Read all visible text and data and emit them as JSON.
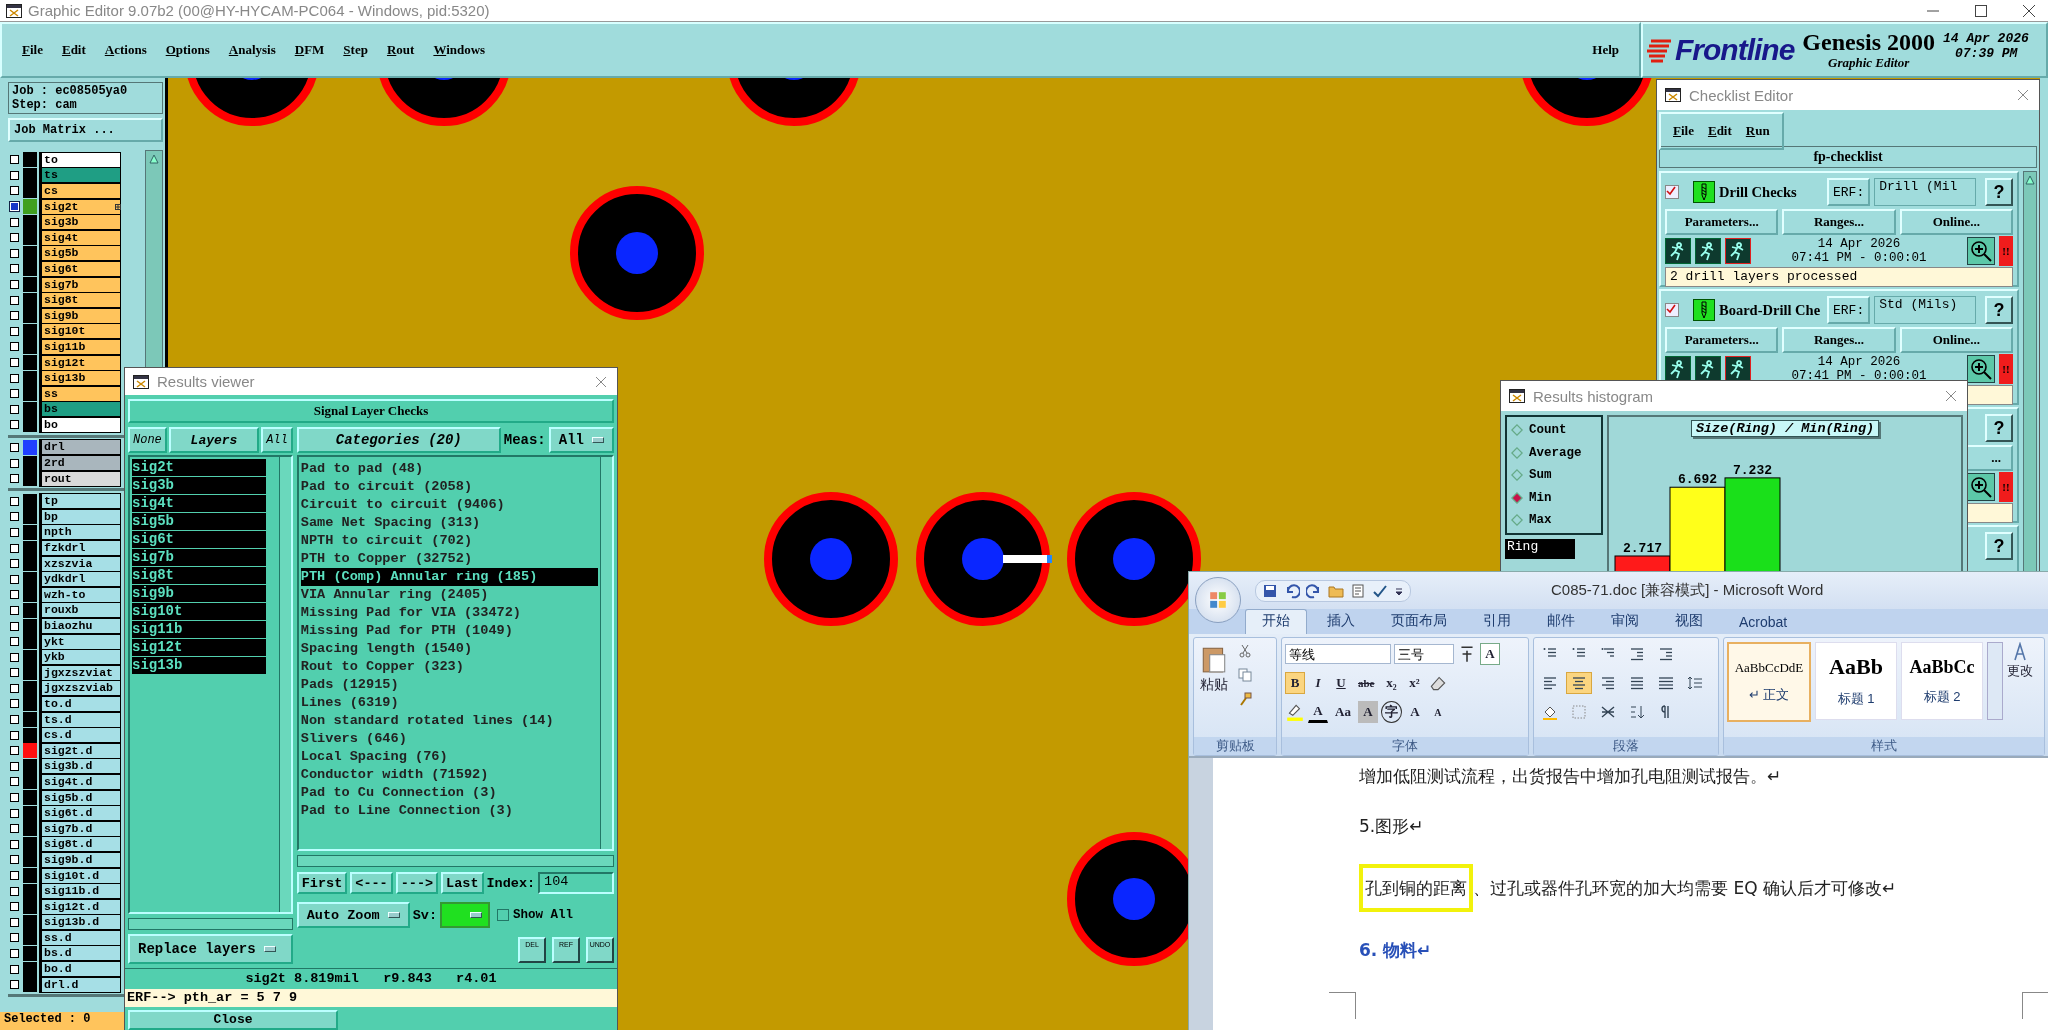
{
  "app": {
    "title": "Graphic Editor 9.07b2 (00@HY-HYCAM-PC064 - Windows, pid:5320)",
    "menu": [
      "File",
      "Edit",
      "Actions",
      "Options",
      "Analysis",
      "DFM",
      "Step",
      "Rout",
      "Windows"
    ],
    "help": "Help",
    "logo": {
      "brand": "Frontline",
      "product": "Genesis 2000",
      "subtitle": "Graphic Editor",
      "date": "14 Apr 2026",
      "time": "07:39 PM"
    }
  },
  "sidebar": {
    "job": "Job : ec08505ya0",
    "step": "Step: cam",
    "matrix_button": "Job Matrix ...",
    "selected_count": "Selected : 0",
    "sections": [
      [
        {
          "name": "to",
          "kind": "silk",
          "selected": false
        },
        {
          "name": "ts",
          "kind": "mask",
          "selected": false
        },
        {
          "name": "cs",
          "kind": "signal",
          "selected": false
        },
        {
          "name": "sig2t",
          "kind": "signal",
          "selected": true,
          "color": "#40a020"
        },
        {
          "name": "sig3b",
          "kind": "signal",
          "selected": false
        },
        {
          "name": "sig4t",
          "kind": "signal",
          "selected": false
        },
        {
          "name": "sig5b",
          "kind": "signal",
          "selected": false
        },
        {
          "name": "sig6t",
          "kind": "signal",
          "selected": false
        },
        {
          "name": "sig7b",
          "kind": "signal",
          "selected": false
        },
        {
          "name": "sig8t",
          "kind": "signal",
          "selected": false
        },
        {
          "name": "sig9b",
          "kind": "signal",
          "selected": false
        },
        {
          "name": "sig10t",
          "kind": "signal",
          "selected": false
        },
        {
          "name": "sig11b",
          "kind": "signal",
          "selected": false
        },
        {
          "name": "sig12t",
          "kind": "signal",
          "selected": false
        },
        {
          "name": "sig13b",
          "kind": "signal",
          "selected": false
        },
        {
          "name": "ss",
          "kind": "signal",
          "selected": false
        },
        {
          "name": "bs",
          "kind": "mask",
          "selected": false
        },
        {
          "name": "bo",
          "kind": "silk",
          "selected": false
        }
      ],
      [
        {
          "name": "drl",
          "kind": "drill",
          "selected": false,
          "color": "#2040ff"
        },
        {
          "name": "2rd",
          "kind": "drill",
          "selected": false
        },
        {
          "name": "rout",
          "kind": "rout",
          "selected": false
        }
      ],
      [
        {
          "name": "tp",
          "kind": "misc",
          "selected": false
        },
        {
          "name": "bp",
          "kind": "misc",
          "selected": false
        },
        {
          "name": "npth",
          "kind": "misc",
          "selected": false
        },
        {
          "name": "fzkdrl",
          "kind": "misc",
          "selected": false
        },
        {
          "name": "xzszvia",
          "kind": "misc",
          "selected": false
        },
        {
          "name": "ydkdrl",
          "kind": "misc",
          "selected": false
        },
        {
          "name": "wzh-to",
          "kind": "misc",
          "selected": false
        },
        {
          "name": "rouxb",
          "kind": "misc",
          "selected": false
        },
        {
          "name": "biaozhu",
          "kind": "misc",
          "selected": false
        },
        {
          "name": "ykt",
          "kind": "misc",
          "selected": false
        },
        {
          "name": "ykb",
          "kind": "misc",
          "selected": false
        },
        {
          "name": "jgxzszviat",
          "kind": "misc",
          "selected": false
        },
        {
          "name": "jgxzszviab",
          "kind": "misc",
          "selected": false
        },
        {
          "name": "to.d",
          "kind": "misc",
          "selected": false
        },
        {
          "name": "ts.d",
          "kind": "misc",
          "selected": false
        },
        {
          "name": "cs.d",
          "kind": "misc",
          "selected": false
        },
        {
          "name": "sig2t.d",
          "kind": "misc",
          "selected": false,
          "color": "#ff1010"
        },
        {
          "name": "sig3b.d",
          "kind": "misc",
          "selected": false
        },
        {
          "name": "sig4t.d",
          "kind": "misc",
          "selected": false
        },
        {
          "name": "sig5b.d",
          "kind": "misc",
          "selected": false
        },
        {
          "name": "sig6t.d",
          "kind": "misc",
          "selected": false
        },
        {
          "name": "sig7b.d",
          "kind": "misc",
          "selected": false
        },
        {
          "name": "sig8t.d",
          "kind": "misc",
          "selected": false
        },
        {
          "name": "sig9b.d",
          "kind": "misc",
          "selected": false
        },
        {
          "name": "sig10t.d",
          "kind": "misc",
          "selected": false
        },
        {
          "name": "sig11b.d",
          "kind": "misc",
          "selected": false
        },
        {
          "name": "sig12t.d",
          "kind": "misc",
          "selected": false
        },
        {
          "name": "sig13b.d",
          "kind": "misc",
          "selected": false
        },
        {
          "name": "ss.d",
          "kind": "misc",
          "selected": false
        },
        {
          "name": "bs.d",
          "kind": "misc",
          "selected": false
        },
        {
          "name": "bo.d",
          "kind": "misc",
          "selected": false
        },
        {
          "name": "drl.d",
          "kind": "misc",
          "selected": false
        }
      ]
    ]
  },
  "results_viewer": {
    "title": "Results viewer",
    "header": "Signal Layer Checks",
    "layer_buttons": [
      "None",
      "Layers",
      "All"
    ],
    "layers": [
      {
        "name": "sig2t",
        "selected": true
      },
      {
        "name": "sig3b",
        "selected": true
      },
      {
        "name": "sig4t",
        "selected": true
      },
      {
        "name": "sig5b",
        "selected": true
      },
      {
        "name": "sig6t",
        "selected": true
      },
      {
        "name": "sig7b",
        "selected": true
      },
      {
        "name": "sig8t",
        "selected": true
      },
      {
        "name": "sig9b",
        "selected": true
      },
      {
        "name": "sig10t",
        "selected": true
      },
      {
        "name": "sig11b",
        "selected": true
      },
      {
        "name": "sig12t",
        "selected": true
      },
      {
        "name": "sig13b",
        "selected": true
      }
    ],
    "layer_action": "Replace layers",
    "categories_button": "Categories (20)",
    "meas_label": "Meas:",
    "meas_value": "All",
    "categories": [
      {
        "label": "Pad to pad (48)",
        "selected": false
      },
      {
        "label": "Pad to circuit (2058)",
        "selected": false
      },
      {
        "label": "Circuit to circuit (9406)",
        "selected": false
      },
      {
        "label": "Same Net Spacing (313)",
        "selected": false
      },
      {
        "label": "NPTH to circuit (702)",
        "selected": false
      },
      {
        "label": "PTH to Copper (32752)",
        "selected": false
      },
      {
        "label": "PTH (Comp) Annular ring (185)",
        "selected": true
      },
      {
        "label": "VIA Annular ring (2405)",
        "selected": false
      },
      {
        "label": "Missing Pad for VIA (33472)",
        "selected": false
      },
      {
        "label": "Missing Pad for PTH (1049)",
        "selected": false
      },
      {
        "label": "Spacing length (1540)",
        "selected": false
      },
      {
        "label": "Rout to Copper (323)",
        "selected": false
      },
      {
        "label": "Pads (12915)",
        "selected": false
      },
      {
        "label": "Lines (6319)",
        "selected": false
      },
      {
        "label": "Non standard rotated lines (14)",
        "selected": false
      },
      {
        "label": "Slivers (646)",
        "selected": false
      },
      {
        "label": "Local Spacing (76)",
        "selected": false
      },
      {
        "label": "Conductor width (71592)",
        "selected": false
      },
      {
        "label": "Pad to Cu Connection (3)",
        "selected": false
      },
      {
        "label": "Pad to Line Connection (3)",
        "selected": false
      }
    ],
    "nav": [
      "First",
      "<---",
      "--->",
      "Last"
    ],
    "index_label": "Index:",
    "index_value": "104",
    "zoom_mode": "Auto Zoom",
    "sv": {
      "label": "Sv:",
      "color": "#20e020"
    },
    "show_all": {
      "label": "Show All",
      "checked": false
    },
    "action_buttons": [
      "DEL",
      "REF",
      "UNDO"
    ],
    "status": "sig2t 8.819mil   r9.843   r4.01",
    "erf": "ERF--> pth_ar = 5 7 9",
    "close": "Close"
  },
  "checklist": {
    "title": "Checklist Editor",
    "menu": [
      "File",
      "Edit",
      "Run"
    ],
    "name": "fp-checklist",
    "checks": [
      {
        "checked": true,
        "name": "Drill Checks",
        "erf_label": "ERF:",
        "erf_value": "Drill (Mil",
        "help": "?",
        "parameters": "Parameters...",
        "ranges": "Ranges...",
        "online": "Online...",
        "date": "14 Apr 2026",
        "time": "07:41 PM - 0:00:01",
        "alert": "!!",
        "status": "2 drill layers processed"
      },
      {
        "checked": true,
        "name": "Board-Drill Che",
        "erf_label": "ERF:",
        "erf_value": "Std (Mils)",
        "help": "?",
        "parameters": "Parameters...",
        "ranges": "Ranges...",
        "online": "Online...",
        "date": "14 Apr 2026",
        "time": "07:41 PM - 0:00:01",
        "alert": "!!"
      },
      {
        "help": "?",
        "online": "...",
        "alert": "!!"
      },
      {
        "help": "?"
      }
    ]
  },
  "histogram": {
    "title": "Results histogram",
    "modes": [
      {
        "label": "Count",
        "selected": false
      },
      {
        "label": "Average",
        "selected": false
      },
      {
        "label": "Sum",
        "selected": false
      },
      {
        "label": "Min",
        "selected": true
      },
      {
        "label": "Max",
        "selected": false
      }
    ],
    "field": "Ring",
    "chart_data": {
      "type": "bar",
      "title": "Size(Ring) / Min(Ring)",
      "values": [
        2.717,
        6.692,
        7.232
      ],
      "colors": [
        "#ff1a1a",
        "#ffff1a",
        "#1ae01a"
      ],
      "data_labels": true
    }
  },
  "word": {
    "title": "C085-71.doc [兼容模式] - Microsoft Word",
    "tabs": [
      {
        "label": "开始",
        "selected": true
      },
      {
        "label": "插入",
        "selected": false
      },
      {
        "label": "页面布局",
        "selected": false
      },
      {
        "label": "引用",
        "selected": false
      },
      {
        "label": "邮件",
        "selected": false
      },
      {
        "label": "审阅",
        "selected": false
      },
      {
        "label": "视图",
        "selected": false
      },
      {
        "label": "Acrobat",
        "selected": false
      }
    ],
    "clipboard": {
      "paste": "粘贴",
      "group": "剪贴板"
    },
    "font": {
      "name": "等线",
      "size": "三号",
      "group": "字体",
      "border_button": "A",
      "style_buttons": [
        {
          "label": "B",
          "selected": true
        },
        {
          "label": "I",
          "selected": false
        },
        {
          "label": "U",
          "selected": false
        },
        {
          "label": "abe",
          "selected": false
        },
        {
          "label": "x₂",
          "selected": false
        },
        {
          "label": "x²",
          "selected": false
        }
      ],
      "effect_buttons": [
        {
          "label": "A",
          "kind": "color"
        },
        {
          "label": "Aa",
          "kind": "menu"
        },
        {
          "label": "A",
          "kind": "shaded"
        },
        {
          "label": "字",
          "kind": "circled"
        },
        {
          "label": "A",
          "kind": "grow"
        },
        {
          "label": "A",
          "kind": "shrink"
        }
      ]
    },
    "paragraph": {
      "group": "段落",
      "align": [
        {
          "selected": false
        },
        {
          "selected": true
        },
        {
          "selected": false
        },
        {
          "selected": false
        },
        {
          "selected": false
        }
      ]
    },
    "styles": {
      "group": "样式",
      "change": "更改",
      "items": [
        {
          "sample": "AaBbCcDdE",
          "label": "↵ 正文",
          "selected": true
        },
        {
          "sample": "AaBb",
          "label": "标题 1",
          "selected": false
        },
        {
          "sample": "AaBbCc",
          "label": "标题 2",
          "selected": false
        }
      ]
    },
    "document": [
      {
        "kind": "body",
        "text": "增加低阻测试流程，出货报告中增加孔电阻测试报告。↵"
      },
      {
        "kind": "body",
        "text": "5.图形↵"
      },
      {
        "kind": "body",
        "marked": "孔到铜的距离",
        "text": "、过孔或器件孔环宽的加大均需要 EQ 确认后才可修改↵"
      },
      {
        "kind": "heading",
        "text": "6.  物料↵"
      }
    ]
  }
}
